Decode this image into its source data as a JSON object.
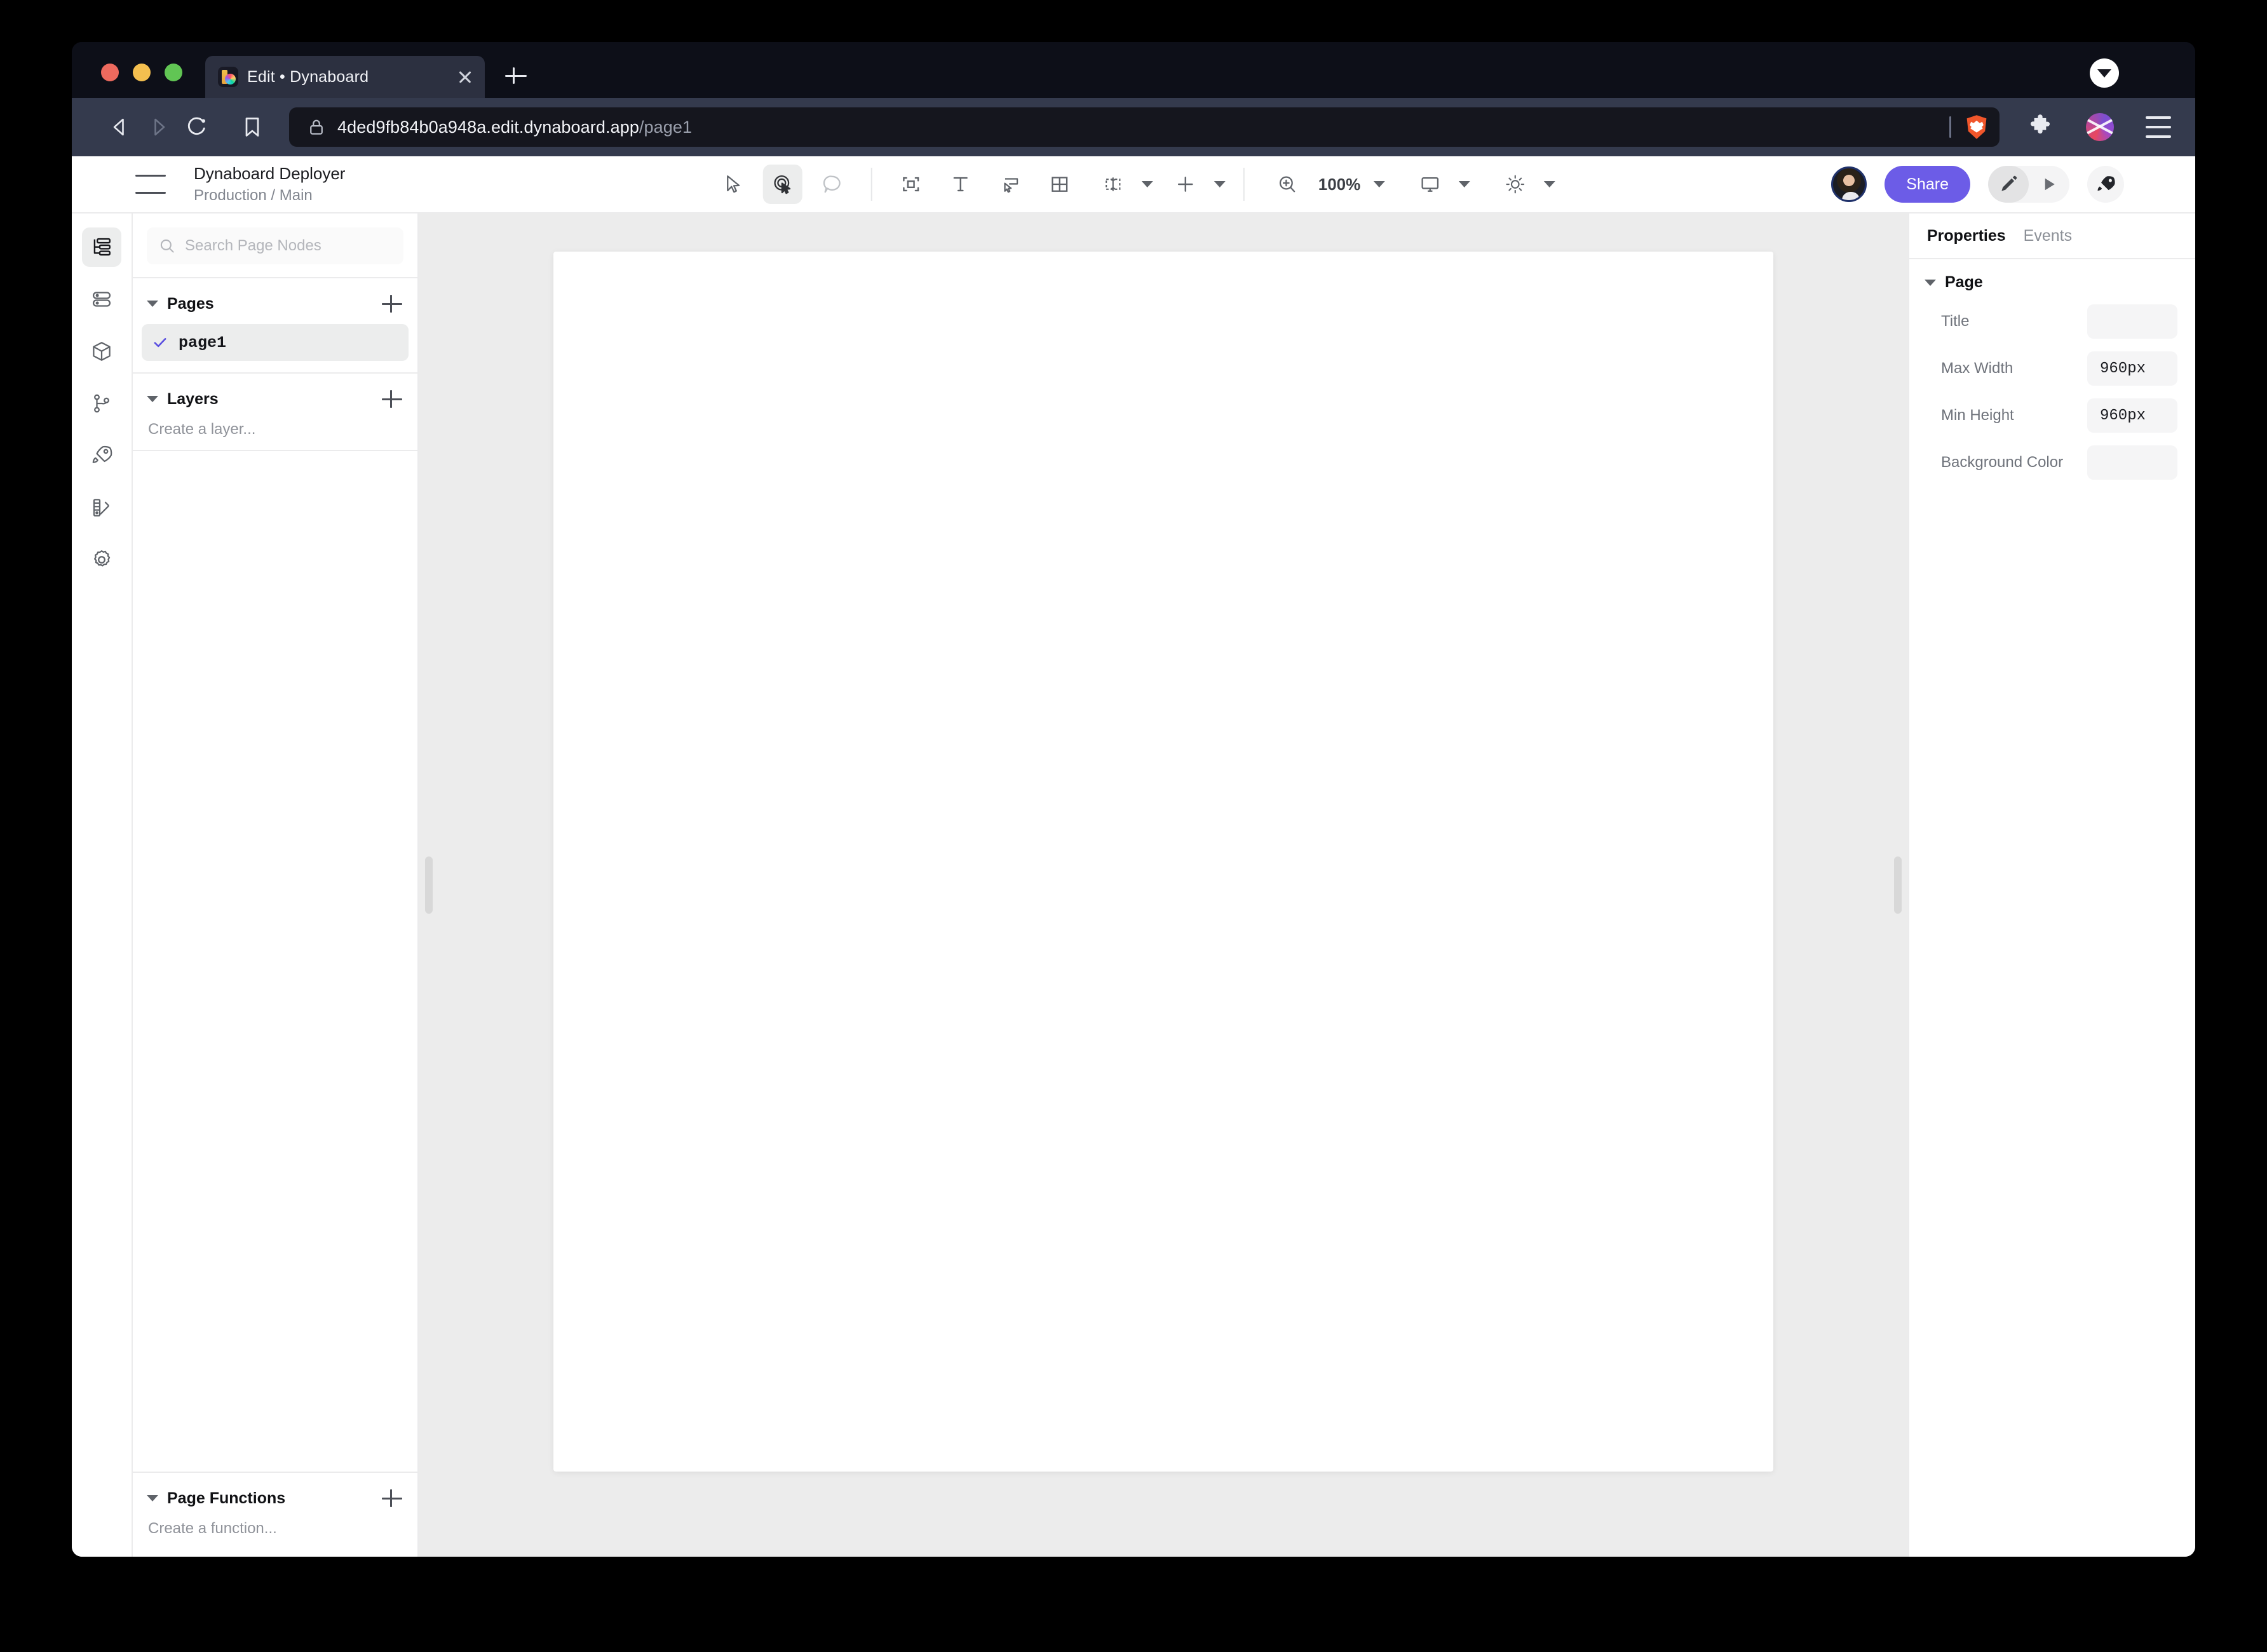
{
  "browser": {
    "tab": {
      "title": "Edit • Dynaboard",
      "favicon_icon": "dynaboard-logo-icon",
      "close_icon": "close-icon"
    },
    "new_tab_icon": "plus-icon",
    "tab_list_icon": "chevron-down-circle-icon",
    "nav": {
      "back_icon": "back-arrow-icon",
      "forward_icon": "forward-arrow-icon",
      "reload_icon": "reload-icon",
      "bookmark_icon": "bookmark-icon"
    },
    "url": {
      "lock_icon": "lock-icon",
      "domain": "4ded9fb84b0a948a.edit.dynaboard.app",
      "path": "/page1"
    },
    "shield_icon": "brave-shield-lion-icon",
    "extensions_icon": "puzzle-piece-icon",
    "profile_icon": "brave-profile-icon",
    "menu_icon": "hamburger-menu-icon",
    "traffic_lights": {
      "close": "#ed6a5e",
      "minimize": "#f4bf4f",
      "zoom": "#61c554"
    }
  },
  "header": {
    "menu_icon": "hamburger-menu-icon",
    "project_name": "Dynaboard Deployer",
    "project_branch": "Production / Main",
    "toolbar": {
      "select_tool": "cursor-select-icon",
      "interact_tool": "interact-pointer-icon",
      "comment_tool": "comment-bubble-icon",
      "container_tool": "container-icon",
      "text_tool": "text-icon",
      "button_tool": "button-icon",
      "table_tool": "table-grid-icon",
      "layout_tool": "layout-distribute-icon",
      "add_tool": "plus-icon",
      "zoom_icon": "zoom-in-icon",
      "zoom_level": "100%",
      "device_icon": "monitor-icon",
      "theme_icon": "sun-icon"
    },
    "avatar_name": "user-avatar",
    "share_label": "Share",
    "edit_mode_icon": "pencil-icon",
    "preview_mode_icon": "play-icon",
    "deploy_icon": "rocket-icon"
  },
  "rail": {
    "items": [
      {
        "name": "page-nodes",
        "icon": "page-tree-icon",
        "active": true
      },
      {
        "name": "data-sources",
        "icon": "database-icon",
        "active": false
      },
      {
        "name": "components",
        "icon": "cube-package-icon",
        "active": false
      },
      {
        "name": "version-control",
        "icon": "git-branch-icon",
        "active": false
      },
      {
        "name": "deployments",
        "icon": "rocket-icon",
        "active": false
      },
      {
        "name": "theme",
        "icon": "color-swatches-icon",
        "active": false
      },
      {
        "name": "settings",
        "icon": "gear-icon",
        "active": false
      }
    ]
  },
  "left_panel": {
    "search": {
      "placeholder": "Search Page Nodes",
      "value": "",
      "icon": "search-icon"
    },
    "pages": {
      "title": "Pages",
      "add_icon": "plus-icon",
      "items": [
        {
          "label": "page1",
          "selected": true,
          "check_icon": "check-icon"
        }
      ]
    },
    "layers": {
      "title": "Layers",
      "add_icon": "plus-icon",
      "empty_text": "Create a layer..."
    },
    "page_functions": {
      "title": "Page Functions",
      "add_icon": "plus-icon",
      "empty_text": "Create a function..."
    }
  },
  "canvas": {
    "background_color": "#ececec",
    "page_background": "#ffffff",
    "left_handle": "panel-resize-handle",
    "right_handle": "panel-resize-handle"
  },
  "properties": {
    "tabs": [
      {
        "label": "Properties",
        "active": true
      },
      {
        "label": "Events",
        "active": false
      }
    ],
    "section_title": "Page",
    "rows": [
      {
        "label": "Title",
        "value": ""
      },
      {
        "label": "Max Width",
        "value": "960px"
      },
      {
        "label": "Min Height",
        "value": "960px"
      },
      {
        "label": "Background Color",
        "value": ""
      }
    ]
  },
  "colors": {
    "accent": "#6c5ce7",
    "panel_border": "#ebebec",
    "canvas_bg": "#ececec"
  }
}
